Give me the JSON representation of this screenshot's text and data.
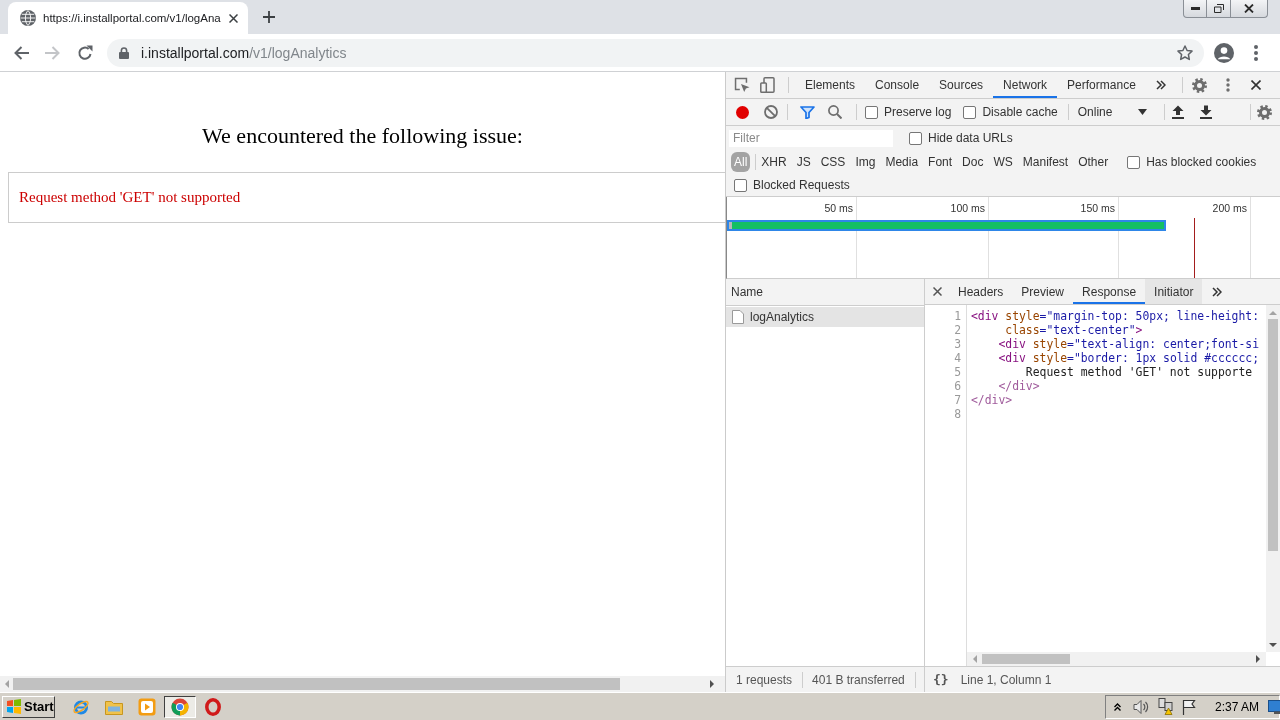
{
  "browser": {
    "tabs": [
      {
        "title": "https://i.installportal.com/v1/logAna",
        "selected": true
      }
    ],
    "nav": [
      {
        "kind": "back",
        "disabled": false
      },
      {
        "kind": "forward",
        "disabled": true
      },
      {
        "kind": "reload",
        "disabled": false
      }
    ],
    "address": {
      "secure": true,
      "host": "i.installportal.com",
      "path": "/v1/logAnalytics"
    },
    "bookmarked": false
  },
  "page": {
    "heading": "We encountered the following issue:",
    "message": "Request method 'GET' not supported"
  },
  "devtools": {
    "tabs": [
      {
        "label": "Elements",
        "selected": false
      },
      {
        "label": "Console",
        "selected": false
      },
      {
        "label": "Sources",
        "selected": false
      },
      {
        "label": "Network",
        "selected": true
      },
      {
        "label": "Performance",
        "selected": false
      }
    ],
    "network": {
      "recording": true,
      "filter_active": true,
      "options": [
        {
          "label": "Preserve log",
          "checked": false
        },
        {
          "label": "Disable cache",
          "checked": false
        }
      ],
      "throttling": "Online",
      "filter": {
        "placeholder": "Filter"
      },
      "hide_data_urls": {
        "label": "Hide data URLs",
        "checked": false
      },
      "types": [
        {
          "label": "All",
          "selected": true
        },
        {
          "label": "XHR",
          "selected": false
        },
        {
          "label": "JS",
          "selected": false
        },
        {
          "label": "CSS",
          "selected": false
        },
        {
          "label": "Img",
          "selected": false
        },
        {
          "label": "Media",
          "selected": false
        },
        {
          "label": "Font",
          "selected": false
        },
        {
          "label": "Doc",
          "selected": false
        },
        {
          "label": "WS",
          "selected": false
        },
        {
          "label": "Manifest",
          "selected": false
        },
        {
          "label": "Other",
          "selected": false
        }
      ],
      "has_blocked_cookies": {
        "label": "Has blocked cookies",
        "checked": false
      },
      "blocked_requests": {
        "label": "Blocked Requests",
        "checked": false
      },
      "overview": {
        "ticks": [
          "50 ms",
          "100 ms",
          "150 ms",
          "200 ms"
        ]
      },
      "requests": {
        "column": "Name",
        "rows": [
          {
            "name": "logAnalytics",
            "selected": true
          }
        ]
      },
      "summary": [
        "1 requests",
        "401 B transferred"
      ],
      "detail": {
        "tabs": [
          {
            "label": "Headers",
            "selected": false,
            "hovered": false
          },
          {
            "label": "Preview",
            "selected": false,
            "hovered": false
          },
          {
            "label": "Response",
            "selected": true,
            "hovered": false
          },
          {
            "label": "Initiator",
            "selected": false,
            "hovered": true
          }
        ],
        "lines": [
          {
            "number": "1",
            "tokens": [
              {
                "kind": "tag",
                "text": "<div"
              },
              {
                "kind": "attribute",
                "text": " style"
              },
              {
                "kind": "value",
                "text": "=\"margin-top: 50px; line-height:"
              }
            ]
          },
          {
            "number": "2",
            "tokens": [
              {
                "kind": "attribute",
                "text": "     class"
              },
              {
                "kind": "value",
                "text": "=\"text-center\""
              },
              {
                "kind": "tag",
                "text": ">"
              }
            ]
          },
          {
            "number": "3",
            "tokens": [
              {
                "kind": "tag",
                "text": "    <div"
              },
              {
                "kind": "attribute",
                "text": " style"
              },
              {
                "kind": "value",
                "text": "=\"text-align: center;font-si"
              }
            ]
          },
          {
            "number": "4",
            "tokens": [
              {
                "kind": "tag",
                "text": "    <div"
              },
              {
                "kind": "attribute",
                "text": " style"
              },
              {
                "kind": "value",
                "text": "=\"border: 1px solid #cccccc;"
              }
            ]
          },
          {
            "number": "5",
            "tokens": [
              {
                "kind": "text",
                "text": "        Request method 'GET' not supporte"
              }
            ]
          },
          {
            "number": "6",
            "tokens": [
              {
                "kind": "end-tag",
                "text": "    </div>"
              }
            ]
          },
          {
            "number": "7",
            "tokens": [
              {
                "kind": "end-tag",
                "text": "</div>"
              }
            ]
          },
          {
            "number": "8"
          }
        ],
        "pretty_print": "{}",
        "cursor": "Line 1, Column 1"
      }
    }
  },
  "taskbar": {
    "start": "Start",
    "apps": [
      {
        "kind": "ie",
        "active": false
      },
      {
        "kind": "folder",
        "active": false
      },
      {
        "kind": "media",
        "active": false
      },
      {
        "kind": "chrome",
        "active": true
      },
      {
        "kind": "opera",
        "active": false
      }
    ],
    "clock": "2:37 AM"
  }
}
